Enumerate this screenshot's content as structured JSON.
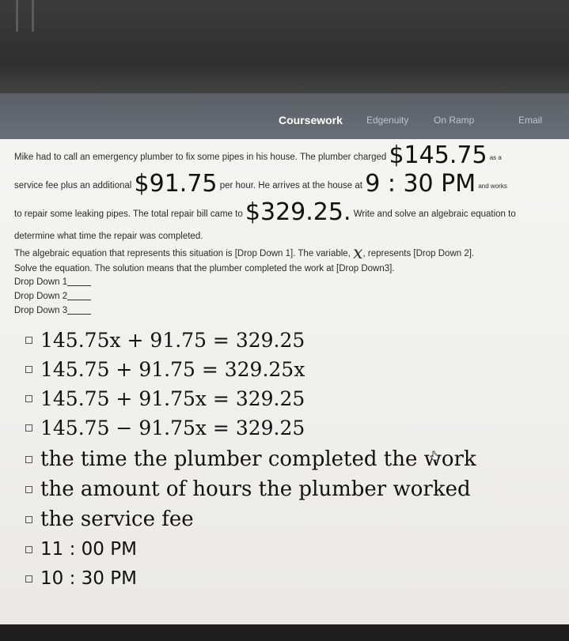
{
  "nav": {
    "tabs": [
      {
        "label": "Coursework"
      },
      {
        "label": "Edgenuity"
      },
      {
        "label": "On Ramp"
      },
      {
        "label": "Email"
      }
    ]
  },
  "problem": {
    "line1_text": "Mike had to call an emergency plumber to fix some pipes in his house. The plumber charged",
    "line1_value": "$145.75",
    "line1_tail": "as a",
    "line2_text": "service fee plus an additional",
    "line2_value": "$91.75",
    "line2_mid": "per hour. He arrives at the house at",
    "line2_time": "9 : 30 PM",
    "line2_tail": "and works",
    "line3_text": "to repair some leaking pipes. The total repair bill came to",
    "line3_value": "$329.25",
    "line3_dot": ".",
    "line3_tail": "Write and solve an algebraic equation to",
    "line4_text": "determine what time the repair was completed.",
    "line5_text_a": "The algebraic equation that represents this situation is [Drop Down 1]. The variable,",
    "line5_var": "x",
    "line5_text_b": ", represents [Drop Down 2].",
    "line6_text": "Solve the equation. The solution means that the plumber completed the work at [Drop Down3].",
    "dropdown_labels": [
      "Drop Down 1",
      "Drop Down 2",
      "Drop Down 3"
    ]
  },
  "options": [
    {
      "text": "145.75x + 91.75 = 329.25"
    },
    {
      "text": "145.75 + 91.75 = 329.25x"
    },
    {
      "text": "145.75 + 91.75x = 329.25"
    },
    {
      "text": "145.75 − 91.75x = 329.25"
    },
    {
      "text": "the time the plumber completed the work"
    },
    {
      "text": "the amount of hours the plumber worked"
    },
    {
      "text": "the service fee"
    },
    {
      "text": "11 : 00 PM"
    },
    {
      "text": "10 : 30 PM"
    }
  ]
}
